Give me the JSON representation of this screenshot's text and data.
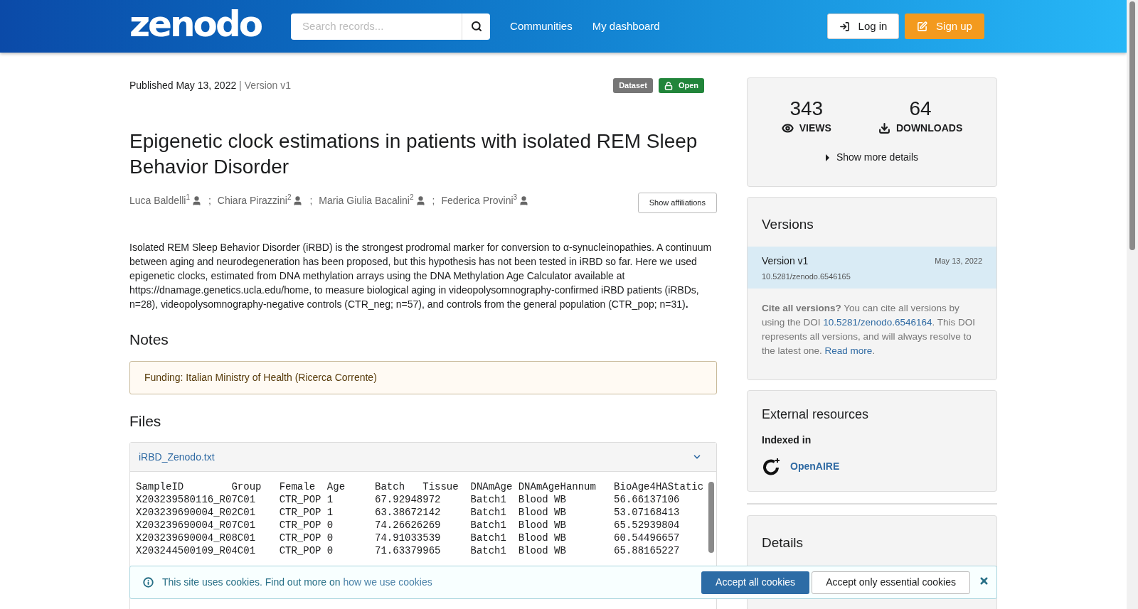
{
  "header": {
    "logo": "zenodo",
    "search": {
      "placeholder": "Search records..."
    },
    "nav": [
      "Communities",
      "My dashboard"
    ],
    "login": "Log in",
    "signup": "Sign up"
  },
  "record": {
    "published": "Published May 13, 2022",
    "version": "| Version v1",
    "badges": [
      {
        "kind": "type",
        "label": "Dataset"
      },
      {
        "kind": "access",
        "label": "Open"
      }
    ],
    "title": "Epigenetic clock estimations in patients with isolated REM Sleep Behavior Disorder",
    "authors": [
      {
        "name": "Luca Baldelli",
        "affiliation": "1",
        "separator": ";"
      },
      {
        "name": "Chiara Pirazzini",
        "affiliation": "2",
        "separator": ";"
      },
      {
        "name": "Maria Giulia Bacalini",
        "affiliation": "2",
        "separator": ";"
      },
      {
        "name": "Federica Provini",
        "affiliation": "3"
      }
    ],
    "show_affiliations": "Show affiliations",
    "description": "Isolated REM Sleep Behavior Disorder (iRBD) is the strongest prodromal marker for conversion to α-synucleinopathies. A continuum between aging and neurodegeneration has been proposed, but this hypothesis has not been tested in iRBD so far. Here we used epigenetic clocks, estimated from DNA methylation arrays using the DNA Methylation Age Calculator available at https://dnamage.genetics.ucla.edu/home, to measure biological aging in videopolysomnography-confirmed iRBD patients (iRBDs, n=28), videopolysomnography-negative controls (CTR_neg; n=57), and controls from the general population (CTR_pop; n=31)**.**",
    "notes": {
      "heading": "Notes",
      "text": "Funding: Italian Ministry of Health (Ricerca Corrente)"
    },
    "files": {
      "heading": "Files",
      "file_name": "iRBD_Zenodo.txt",
      "expanded": true,
      "rows": [
        "SampleID\tGroup\tFemale\tAge\tBatch\tTissue\tDNAmAge\tDNAmAgeHannum\tBioAge4HAStatic",
        "X203239580116_R07C01\tCTR_POP\t1\t67.92948972\tBatch1\tBlood WB\t56.66137106",
        "X203239690004_R02C01\tCTR_POP\t1\t63.38672142\tBatch1\tBlood WB\t53.07168413",
        "X203239690004_R07C01\tCTR_POP\t0\t74.26626269\tBatch1\tBlood WB\t65.52939804",
        "X203239690004_R08C01\tCTR_POP\t0\t74.91033539\tBatch1\tBlood WB\t60.54496657",
        "X203244500109_R04C01\tCTR_POP\t0\t71.63379965\tBatch1\tBlood WB\t65.88165227"
      ]
    }
  },
  "sidebar": {
    "stats": [
      {
        "kind": "views",
        "count": "343",
        "label": "VIEWS"
      },
      {
        "kind": "downloads",
        "count": "64",
        "label": "DOWNLOADS"
      }
    ],
    "more_details": "Show more details",
    "versions": {
      "heading": "Versions",
      "items": [
        {
          "label": "Version v1",
          "date": "May 13, 2022",
          "doi": "10.5281/zenodo.6546165",
          "selected": true
        }
      ],
      "cite_lead": "Cite all versions?",
      "cite_text": "You can cite all versions by using the DOI",
      "cite_doi": "10.5281/zenodo.6546164",
      "cite_rest": ". This DOI represents all versions, and will always resolve to the latest one.",
      "read_more": "Read more",
      "cite_end": "."
    },
    "external": {
      "heading": "External resources",
      "indexed_label": "Indexed in",
      "indexes": [
        "OpenAIRE"
      ]
    },
    "details": {
      "heading": "Details"
    }
  },
  "cookie_banner": {
    "text": "This site uses cookies. Find out more on",
    "link": "how we use cookies",
    "accept_all": "Accept all cookies",
    "accept_essential": "Accept only essential cookies"
  }
}
